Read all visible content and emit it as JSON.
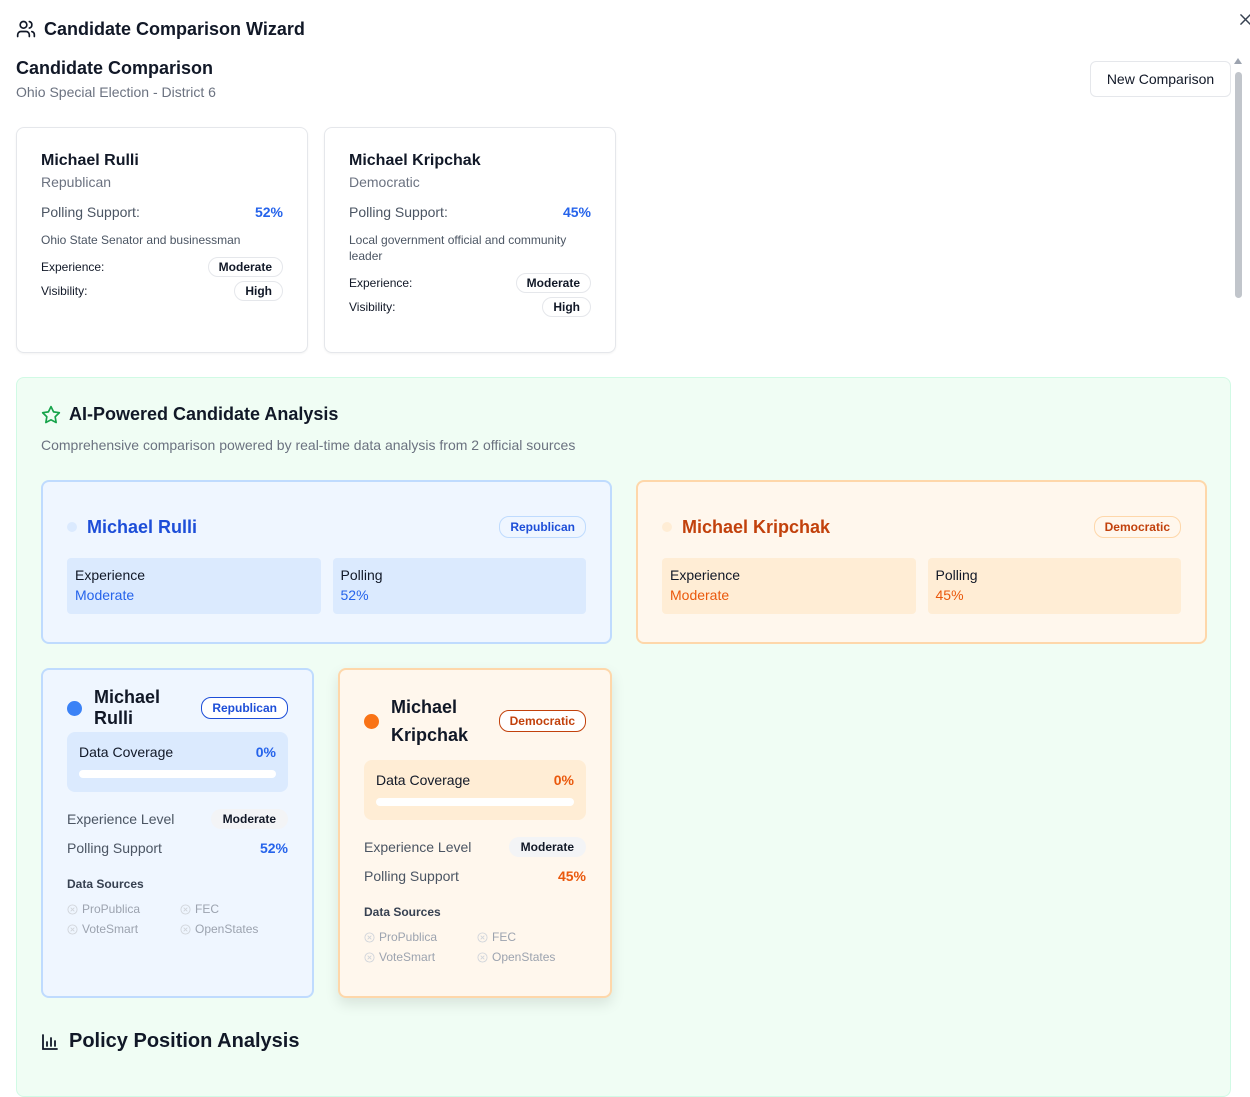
{
  "header": {
    "wizard_title": "Candidate Comparison Wizard",
    "icons": {
      "wizard": "users-icon",
      "close": "close-icon"
    }
  },
  "page": {
    "title": "Candidate Comparison",
    "subtitle": "Ohio Special Election - District 6",
    "new_button": "New Comparison"
  },
  "candidates": [
    {
      "name": "Michael Rulli",
      "party": "Republican",
      "polling_label": "Polling Support:",
      "polling": "52%",
      "description": "Ohio State Senator and businessman",
      "experience_label": "Experience:",
      "experience": "Moderate",
      "visibility_label": "Visibility:",
      "visibility": "High"
    },
    {
      "name": "Michael Kripchak",
      "party": "Democratic",
      "polling_label": "Polling Support:",
      "polling": "45%",
      "description": "Local government official and community leader",
      "experience_label": "Experience:",
      "experience": "Moderate",
      "visibility_label": "Visibility:",
      "visibility": "High"
    }
  ],
  "ai": {
    "title": "AI-Powered Candidate Analysis",
    "subtitle": "Comprehensive comparison powered by real-time data analysis from 2 official sources",
    "icon": "star-icon",
    "summary": [
      {
        "name": "Michael Rulli",
        "party": "Republican",
        "exp_label": "Experience",
        "exp": "Moderate",
        "poll_label": "Polling",
        "poll": "52%"
      },
      {
        "name": "Michael Kripchak",
        "party": "Democratic",
        "exp_label": "Experience",
        "exp": "Moderate",
        "poll_label": "Polling",
        "poll": "45%"
      }
    ],
    "details": [
      {
        "name": "Michael Rulli",
        "party": "Republican",
        "coverage_label": "Data Coverage",
        "coverage": "0%",
        "coverage_fraction": 0,
        "exp_label": "Experience Level",
        "exp": "Moderate",
        "poll_label": "Polling Support",
        "poll": "52%",
        "sources_label": "Data Sources",
        "sources": [
          "ProPublica",
          "FEC",
          "VoteSmart",
          "OpenStates"
        ]
      },
      {
        "name": "Michael Kripchak",
        "party": "Democratic",
        "coverage_label": "Data Coverage",
        "coverage": "0%",
        "coverage_fraction": 0,
        "exp_label": "Experience Level",
        "exp": "Moderate",
        "poll_label": "Polling Support",
        "poll": "45%",
        "sources_label": "Data Sources",
        "sources": [
          "ProPublica",
          "FEC",
          "VoteSmart",
          "OpenStates"
        ]
      }
    ]
  },
  "policy": {
    "title": "Policy Position Analysis",
    "icon": "bar-chart-icon"
  },
  "colors": {
    "republican": "#1d4ed8",
    "democratic": "#c2410c",
    "accent_green": "#16a34a"
  }
}
